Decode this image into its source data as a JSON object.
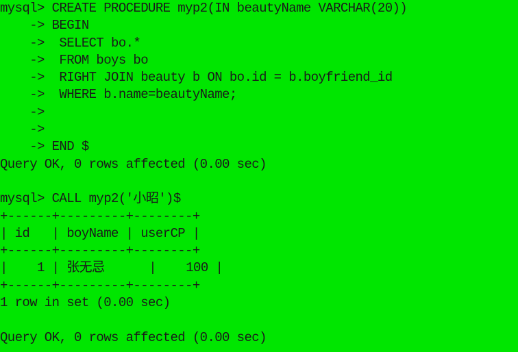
{
  "terminal": {
    "lines": [
      "mysql> CREATE PROCEDURE myp2(IN beautyName VARCHAR(20))",
      "    -> BEGIN",
      "    ->  SELECT bo.*",
      "    ->  FROM boys bo",
      "    ->  RIGHT JOIN beauty b ON bo.id = b.boyfriend_id",
      "    ->  WHERE b.name=beautyName;",
      "    ->",
      "    ->",
      "    -> END $",
      "Query OK, 0 rows affected (0.00 sec)",
      "",
      "mysql> CALL myp2('小昭')$",
      "+------+---------+--------+",
      "| id   | boyName | userCP |",
      "+------+---------+--------+",
      "|    1 | 张无忌      |    100 |",
      "+------+---------+--------+",
      "1 row in set (0.00 sec)",
      "",
      "Query OK, 0 rows affected (0.00 sec)"
    ]
  }
}
